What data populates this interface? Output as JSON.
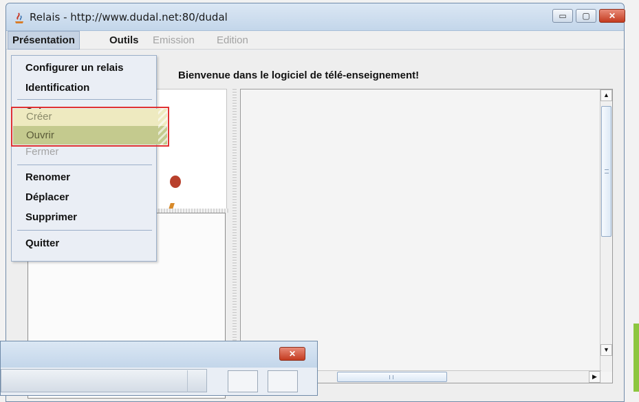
{
  "window": {
    "title": "Relais - http://www.dudal.net:80/dudal",
    "minimize_symbol": "▭",
    "maximize_symbol": "▢",
    "close_symbol": "✕"
  },
  "menubar": {
    "items": [
      {
        "label": "Présentation",
        "state": "open"
      },
      {
        "label": "Outils",
        "state": "enabled"
      },
      {
        "label": "Emission",
        "state": "disabled"
      },
      {
        "label": "Edition",
        "state": "disabled"
      }
    ]
  },
  "welcome": "Bienvenue dans le logiciel de télé-enseignement!",
  "dropdown": {
    "items": [
      {
        "label": "Configurer un relais",
        "state": "enabled"
      },
      {
        "label": "Identification",
        "state": "enabled"
      },
      {
        "label": "Créer",
        "state": "highlighted"
      },
      {
        "label": "Ouvrir",
        "state": "highlighted"
      },
      {
        "label": "Fermer",
        "state": "disabled"
      },
      {
        "label": "Renomer",
        "state": "enabled"
      },
      {
        "label": "Déplacer",
        "state": "enabled"
      },
      {
        "label": "Supprimer",
        "state": "enabled"
      },
      {
        "label": "Quitter",
        "state": "enabled"
      }
    ]
  },
  "scrollbars": {
    "up_arrow": "▲",
    "down_arrow": "▼",
    "right_arrow": "▶"
  },
  "secondary_window": {
    "close_symbol": "✕"
  },
  "colors": {
    "highlight_border": "#e03131",
    "accent_green": "#8cc63f",
    "menu_open_bg": "#c6d3e3"
  }
}
